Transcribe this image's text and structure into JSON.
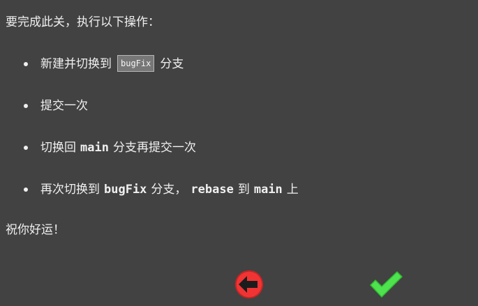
{
  "intro": "要完成此关，执行以下操作：",
  "steps": [
    {
      "before": "新建并切换到",
      "chip": "bugFix",
      "after": "分支"
    },
    {
      "text": "提交一次"
    },
    {
      "before": "切换回",
      "code": "main",
      "after": "分支再提交一次"
    },
    {
      "before": "再次切换到",
      "code1": "bugFix",
      "middle1": "分支，",
      "code2": "rebase",
      "middle2": "到",
      "code3": "main",
      "after": "上"
    }
  ],
  "outro": "祝你好运！",
  "buttons": {
    "back_icon": "arrow-left-circle-icon",
    "confirm_icon": "checkmark-icon"
  },
  "colors": {
    "background": "#424242",
    "text": "#f0f0f0",
    "back_button": "#f03434",
    "confirm_button": "#4ee24e"
  }
}
